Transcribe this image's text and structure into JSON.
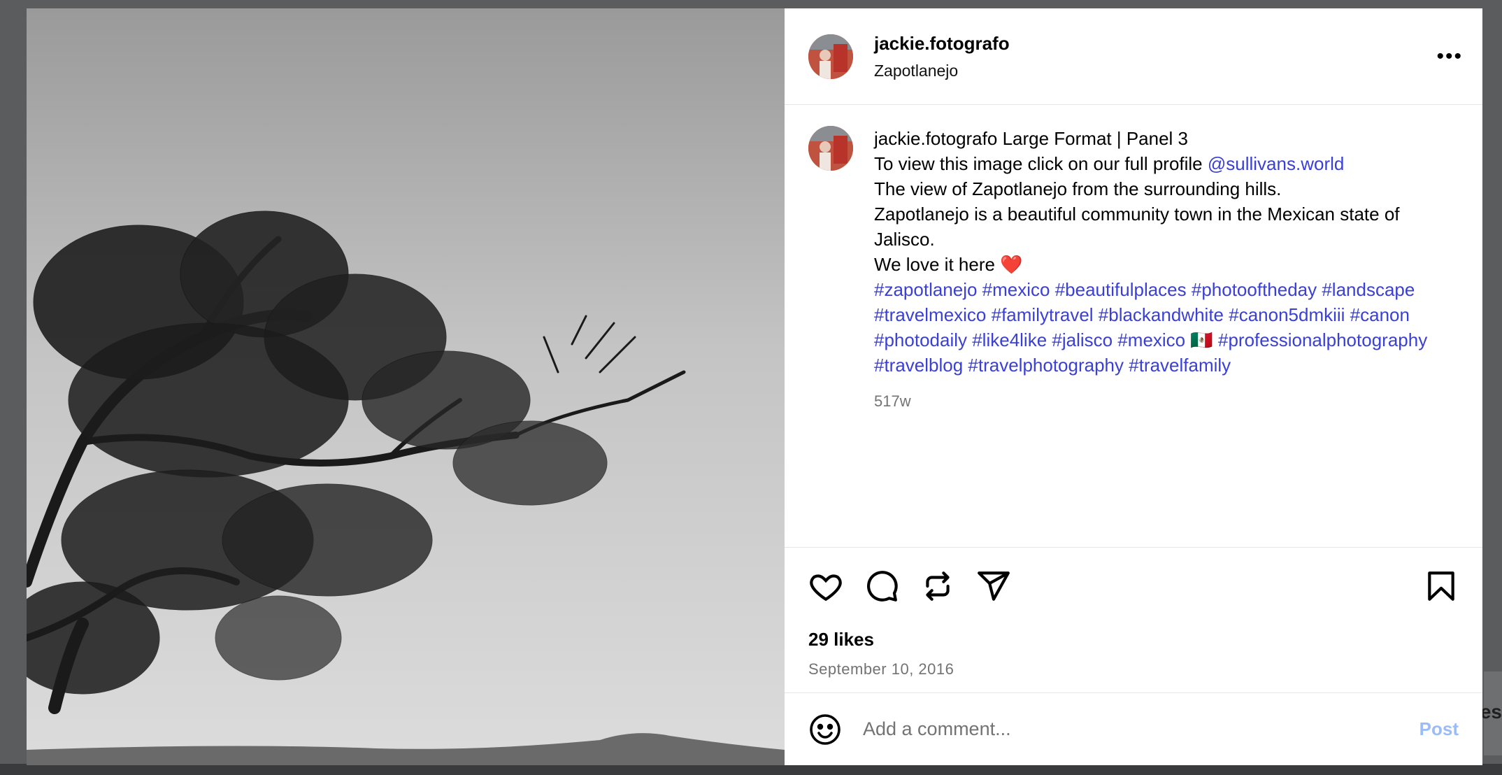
{
  "post": {
    "username": "jackie.fotografo",
    "location": "Zapotlanejo",
    "more_icon_text": "•••"
  },
  "caption": {
    "username": "jackie.fotografo",
    "title": "Large Format | Panel 3",
    "line1_prefix": "To view this image click on our full profile",
    "mention": "@sullivans.world",
    "line2": "The view of Zapotlanejo from the surrounding hills.",
    "line3": "Zapotlanejo is a beautiful community town in the Mexican state of Jalisco.",
    "line4": "We love it here ❤️",
    "hashtags_a": "#zapotlanejo #mexico #beautifulplaces #photooftheday #landscape #travelmexico #familytravel #blackandwhite #canon5dmkiii #canon #photodaily #like4like #jalisco #mexico",
    "flag": "🇲🇽",
    "hashtags_b": "#professionalphotography #travelblog #travelphotography #travelfamily",
    "age": "517w"
  },
  "actions": {
    "icons": [
      "heart-icon",
      "comment-icon",
      "repost-icon",
      "share-icon",
      "bookmark-icon"
    ],
    "likes": "29 likes",
    "date": "September 10, 2016"
  },
  "comment_box": {
    "placeholder": "Add a comment...",
    "post_label": "Post"
  },
  "backdrop": {
    "partial_text": "es"
  },
  "colors": {
    "link": "#3a3fd6",
    "post_disabled": "#9bbcf7",
    "muted": "#737373"
  }
}
